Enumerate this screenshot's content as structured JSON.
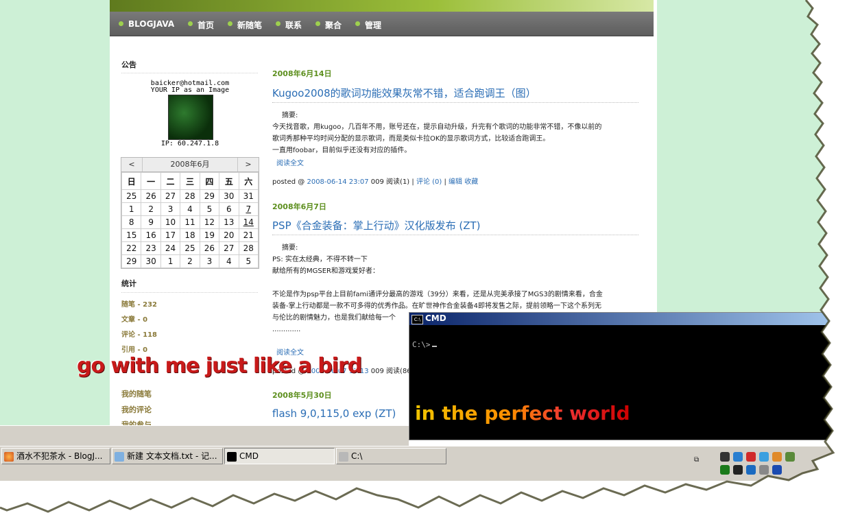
{
  "nav": {
    "items": [
      "BLOGJAVA",
      "首页",
      "新随笔",
      "联系",
      "聚合",
      "管理"
    ]
  },
  "sidebar": {
    "notice_heading": "公告",
    "email": "baicker@hotmail.com",
    "ip_caption": "YOUR IP as an Image",
    "ip_value": "IP: 60.247.1.8",
    "calendar": {
      "prev": "<",
      "next": ">",
      "title": "2008年6月",
      "weekdays": [
        "日",
        "一",
        "二",
        "三",
        "四",
        "五",
        "六"
      ],
      "weeks": [
        [
          "25",
          "26",
          "27",
          "28",
          "29",
          "30",
          "31"
        ],
        [
          "1",
          "2",
          "3",
          "4",
          "5",
          "6",
          "7"
        ],
        [
          "8",
          "9",
          "10",
          "11",
          "12",
          "13",
          "14"
        ],
        [
          "15",
          "16",
          "17",
          "18",
          "19",
          "20",
          "21"
        ],
        [
          "22",
          "23",
          "24",
          "25",
          "26",
          "27",
          "28"
        ],
        [
          "29",
          "30",
          "1",
          "2",
          "3",
          "4",
          "5"
        ]
      ]
    },
    "stats_heading": "统计",
    "stats": [
      "随笔 - 232",
      "文章 - 0",
      "评论 - 118",
      "引用 - 0"
    ],
    "links": [
      "我的随笔",
      "我的评论",
      "我的参与"
    ]
  },
  "posts": [
    {
      "date": "2008年6月14日",
      "title": "Kugoo2008的歌词功能效果灰常不错，适合跑调王（图）",
      "summary_label": "摘要:",
      "body": [
        "今天找音歌，用kugoo，几百年不用，账号还在，提示自动升级，升完有个歌词的功能非常不错，不像以前的",
        "歌词秀那种平均时间分配的显示歌词，而是类似卡拉OK的显示歌词方式，比较适合跑调王。",
        "一直用foobar，目前似乎还没有对应的插件。"
      ],
      "read_more": "阅读全文",
      "posted_prefix": "posted @",
      "posted_date": "2008-06-14 23:07",
      "posted_meta": "009 阅读(1) |",
      "comments": "评论 (0)",
      "edit": "编辑",
      "favorite": "收藏"
    },
    {
      "date": "2008年6月7日",
      "title": "PSP《合金装备：掌上行动》汉化版发布 (ZT)",
      "summary_label": "摘要:",
      "body": [
        "PS: 实在太经典，不得不转一下",
        "献给所有的MGSER和游戏爱好者：",
        "",
        "不论是作为psp平台上目前fami通评分最高的游戏（39分）来看，还是从完美承接了MGS3的剧情来看，合金",
        "装备-掌上行动都是一款不可多得的优秀作品。在旷世神作合金装备4即将发售之际，提前领略一下这个系列无",
        "与伦比的剧情魅力，也是我们献给每一个",
        "............."
      ],
      "read_more": "阅读全文",
      "posted_prefix": "posted @",
      "posted_date": "2008-06-07 13:13",
      "posted_meta": "009 阅读(86"
    },
    {
      "date": "2008年5月30日",
      "title": "flash 9,0,115,0 exp (ZT)"
    }
  ],
  "overlays": {
    "bird": "go with me just like a bird",
    "world": "in the perfect world"
  },
  "cmd": {
    "title": "CMD",
    "icon_text": "C:\\",
    "prompt": "C:\\>"
  },
  "taskbar": {
    "tasks": [
      "酒水不犯茶水 - BlogJ...",
      "新建 文本文档.txt - 记...",
      "CMD",
      "C:\\"
    ]
  },
  "colors": {
    "accent_green": "#5d8f1e",
    "link_blue": "#2a6db5",
    "page_bg": "#cdf0d6"
  }
}
